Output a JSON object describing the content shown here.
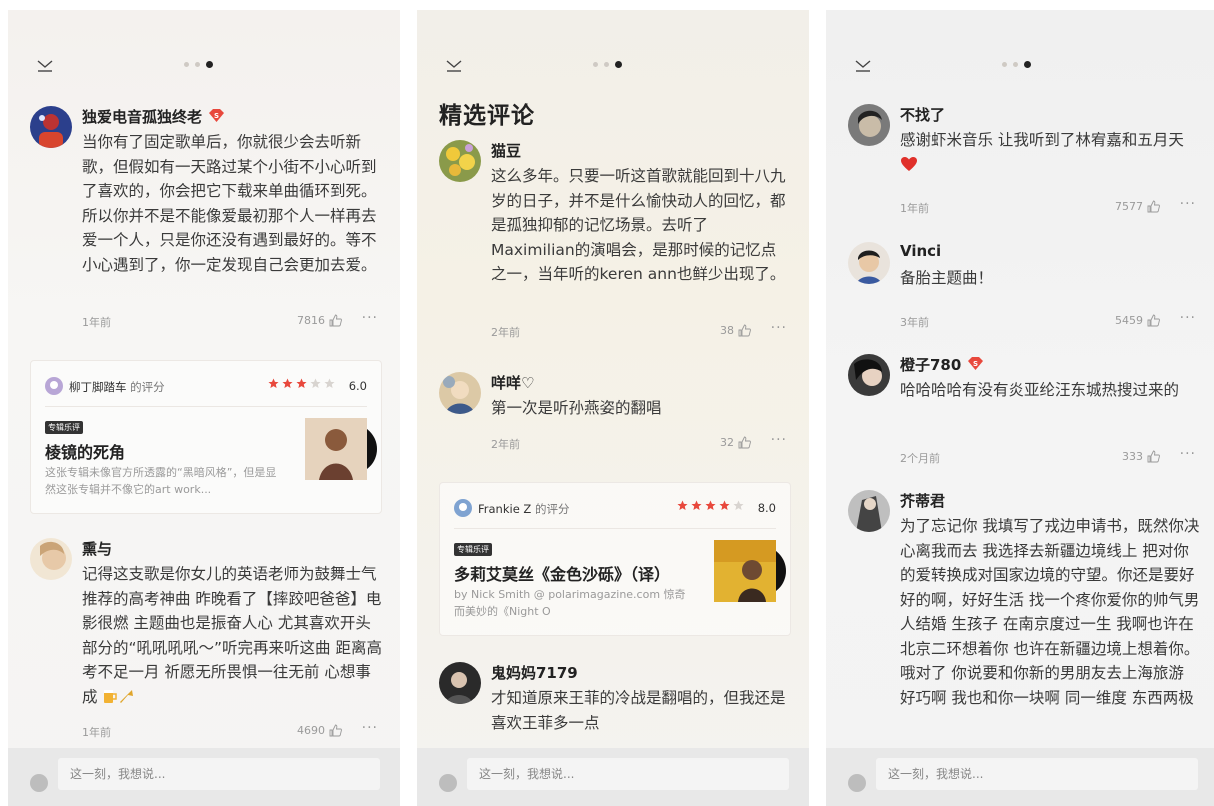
{
  "colors": {
    "accent_red": "#e8483c",
    "text_dark": "#222222",
    "text_muted": "#9a9a9a",
    "bottom_bar": "#e8e8e8"
  },
  "panels": [
    {
      "page_indicator": {
        "count": 3,
        "active": 3
      },
      "comments": [
        {
          "name": "独爱电音孤独终老",
          "vip": true,
          "text": "当你有了固定歌单后，你就很少会去听新歌，但假如有一天路过某个小街不小心听到了喜欢的，你会把它下载来单曲循环到死。所以你并不是不能像爱最初那个人一样再去爱一个人，只是你还没有遇到最好的。等不小心遇到了，你一定发现自己会更加去爱。",
          "time": "1年前",
          "likes": "7816",
          "more": "···"
        },
        {
          "name": "熏与",
          "vip": false,
          "text": "记得这支歌是你女儿的英语老师为鼓舞士气推荐的高考神曲 昨晚看了【摔跤吧爸爸】电影很燃 主题曲也是振奋人心 尤其喜欢开头部分的“吼吼吼吼～”听完再来听这曲 距离高考不足一月 祈愿无所畏惧一往无前 心想事成",
          "time": "1年前",
          "likes": "4690",
          "more": "···"
        }
      ],
      "rating_card": {
        "user": "柳丁脚踏车",
        "suffix": "的评分",
        "stars": 3,
        "score": "6.0",
        "tag": "专辑乐评",
        "album_title": "棱镜的死角",
        "desc": "这张专辑未像官方所透露的“黑暗风格”，但是显然这张专辑并不像它的art work..."
      },
      "input_placeholder": "这一刻，我想说..."
    },
    {
      "section_title": "精选评论",
      "comments": [
        {
          "name": "猫豆",
          "vip": false,
          "text": "这么多年。只要一听这首歌就能回到十八九岁的日子，并不是什么愉快动人的回忆，都是孤独抑郁的记忆场景。去听了Maximilian的演唱会，是那时候的记忆点之一，当年听的keren ann也鲜少出现了。",
          "time": "2年前",
          "likes": "38",
          "more": "···"
        },
        {
          "name": "咩咩♡",
          "vip": false,
          "text": "第一次是听孙燕姿的翻唱",
          "time": "2年前",
          "likes": "32",
          "more": "···"
        },
        {
          "name": "鬼妈妈7179",
          "vip": false,
          "text": "才知道原来王菲的冷战是翻唱的，但我还是喜欢王菲多一点",
          "time": "",
          "likes": "",
          "more": ""
        }
      ],
      "rating_card": {
        "user": "Frankie Z",
        "suffix": "的评分",
        "stars": 4,
        "score": "8.0",
        "tag": "专辑乐评",
        "album_title": "多莉艾莫丝《金色沙砾》（译）",
        "desc": "by Nick Smith @ polarimagazine.com 惊奇而美妙的《Night O"
      },
      "input_placeholder": "这一刻，我想说..."
    },
    {
      "comments": [
        {
          "name": "不找了",
          "vip": false,
          "text": "感谢虾米音乐 让我听到了林宥嘉和五月天",
          "time": "1年前",
          "likes": "7577",
          "more": "···"
        },
        {
          "name": "Vinci",
          "vip": false,
          "text": "备胎主题曲！",
          "time": "3年前",
          "likes": "5459",
          "more": "···"
        },
        {
          "name": "橙子780",
          "vip": true,
          "text": "哈哈哈哈有没有炎亚纶汪东城热搜过来的",
          "time": "2个月前",
          "likes": "333",
          "more": "···"
        },
        {
          "name": "芥蒂君",
          "vip": false,
          "text": "为了忘记你 我填写了戎边申请书，既然你决心离我而去 我选择去新疆边境线上 把对你的爱转换成对国家边境的守望。你还是要好好的啊，好好生活 找一个疼你爱你的帅气男人结婚 生孩子 在南京度过一生 我啊也许在北京二环想着你 也许在新疆边境上想着你。哦对了 你说要和你新的男朋友去上海旅游 好巧啊 我也和你一块啊 同一维度 东西两极",
          "time": "",
          "likes": "",
          "more": ""
        }
      ],
      "input_placeholder": "这一刻，我想说..."
    }
  ]
}
